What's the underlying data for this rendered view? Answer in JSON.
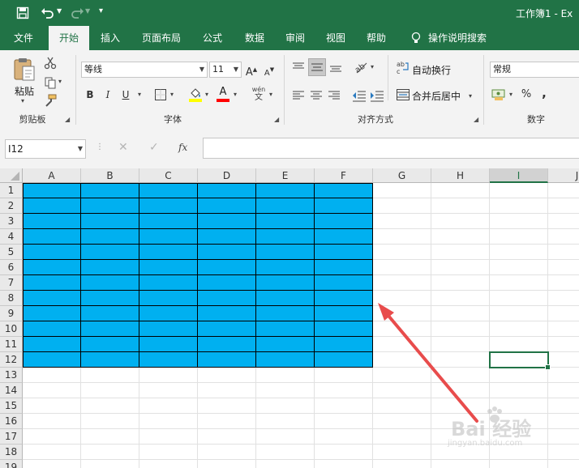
{
  "window": {
    "title": "工作簿1 - Ex"
  },
  "tabs": [
    "文件",
    "开始",
    "插入",
    "页面布局",
    "公式",
    "数据",
    "审阅",
    "视图",
    "帮助"
  ],
  "tell_me": "操作说明搜索",
  "clipboard": {
    "paste_label": "粘贴",
    "group_label": "剪贴板"
  },
  "font": {
    "name": "等线",
    "size": "11",
    "group_label": "字体",
    "bold": "B",
    "italic": "I",
    "underline": "U",
    "grow": "A",
    "shrink": "A",
    "font_color_letter": "A",
    "phonetic": "wén"
  },
  "alignment": {
    "wrap_label": "自动换行",
    "merge_label": "合并后居中",
    "group_label": "对齐方式"
  },
  "number": {
    "format": "常规",
    "group_label": "数字",
    "percent": "%",
    "comma": ","
  },
  "formula_bar": {
    "name_box": "I12",
    "fx": "fx",
    "value": ""
  },
  "grid": {
    "columns": [
      "A",
      "B",
      "C",
      "D",
      "E",
      "F",
      "G",
      "H",
      "I",
      "J"
    ],
    "selected_column": "I",
    "rows": [
      "1",
      "2",
      "3",
      "4",
      "5",
      "6",
      "7",
      "8",
      "9",
      "10",
      "11",
      "12",
      "13",
      "14",
      "15",
      "16",
      "17",
      "18",
      "19"
    ],
    "fill_range": "A1:F12",
    "fill_color": "#00b0f0",
    "selected_cell": "I12"
  },
  "colors": {
    "accent": "#217346",
    "font_color_bar": "#ff0000",
    "fill_color_bar": "#ffff00",
    "arrow": "#e84c4c"
  },
  "watermark": {
    "brand": "Bai 经验",
    "url": "jingyan.baidu.com"
  }
}
